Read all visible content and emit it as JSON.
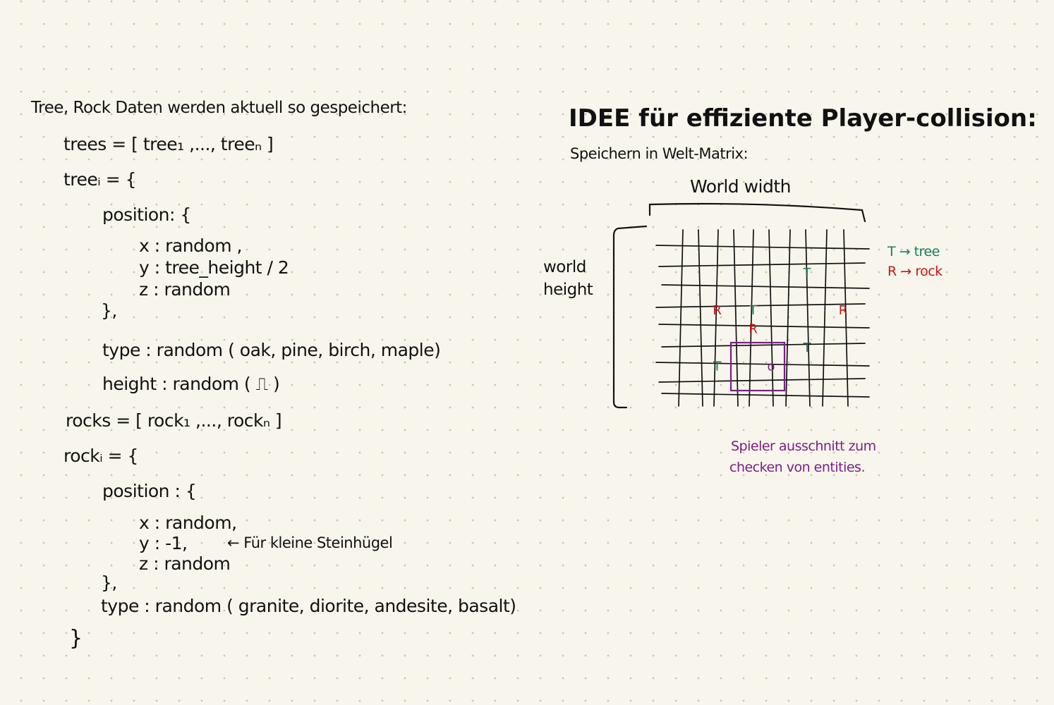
{
  "notes": {
    "heading": "Tree, Rock Daten werden aktuell so gespeichert:",
    "lines": [
      "trees = [ tree₁ ,..., treeₙ ]",
      "treeᵢ = {",
      "position: {",
      "x : random ,",
      "y : tree_height / 2",
      "z : random",
      "},",
      "type : random ( oak, pine, birch, maple)",
      "height : random ( ⎍ )",
      "rocks = [ rock₁ ,..., rockₙ ]",
      "rockᵢ = {",
      "position : {",
      "x : random,",
      "y : -1,",
      "z : random",
      "},",
      "type : random ( granite, diorite, andesite, basalt)",
      "}"
    ],
    "annotation": "← Für kleine Steinhügel"
  },
  "idea": {
    "title": "IDEE für effiziente Player-collision:",
    "subtitle": "Speichern in Welt-Matrix:",
    "width_label": "World width",
    "height_label_1": "world",
    "height_label_2": "height",
    "legend": [
      {
        "text": "T → tree",
        "color": "#1a7a5c"
      },
      {
        "text": "R → rock",
        "color": "#c01818"
      }
    ],
    "markers": [
      {
        "letter": "T",
        "col": 8,
        "row": 2,
        "color": "#1a7a5c"
      },
      {
        "letter": "R",
        "col": 3,
        "row": 4,
        "color": "#c01818"
      },
      {
        "letter": "T",
        "col": 5,
        "row": 4,
        "color": "#1a7a5c"
      },
      {
        "letter": "R",
        "col": 10,
        "row": 4,
        "color": "#c01818"
      },
      {
        "letter": "R",
        "col": 5,
        "row": 5,
        "color": "#c01818"
      },
      {
        "letter": "T",
        "col": 8,
        "row": 6,
        "color": "#1a7a5c"
      },
      {
        "letter": "T",
        "col": 3,
        "row": 7,
        "color": "#1a7a5c"
      },
      {
        "letter": "o",
        "col": 6,
        "row": 7,
        "color": "#7a1f86"
      }
    ],
    "player_box_color": "#7a1f86",
    "caption_1": "Spieler ausschnitt zum",
    "caption_2": "checken von entities."
  }
}
